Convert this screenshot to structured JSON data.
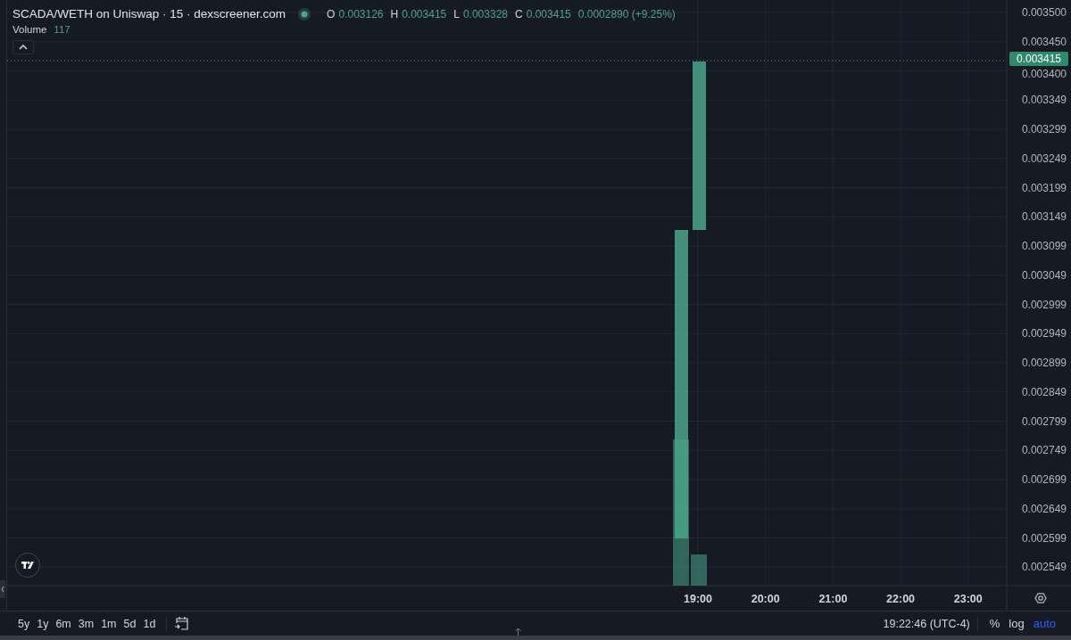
{
  "header": {
    "title": "SCADA/WETH on Uniswap · 15 · dexscreener.com",
    "ohlc": [
      {
        "label": "O",
        "value": "0.003126"
      },
      {
        "label": "H",
        "value": "0.003415"
      },
      {
        "label": "L",
        "value": "0.003328"
      },
      {
        "label": "C",
        "value": "0.003415"
      }
    ],
    "change": "0.0002890 (+9.25%)",
    "volume_label": "Volume",
    "volume_value": "117"
  },
  "price_label": "0.003415",
  "price_axis": [
    "0.003500",
    "0.003450",
    "0.003400",
    "0.003349",
    "0.003299",
    "0.003249",
    "0.003199",
    "0.003149",
    "0.003099",
    "0.003049",
    "0.002999",
    "0.002949",
    "0.002899",
    "0.002849",
    "0.002799",
    "0.002749",
    "0.002699",
    "0.002649",
    "0.002599",
    "0.002549"
  ],
  "time_axis": [
    "19:00",
    "20:00",
    "21:00",
    "22:00",
    "23:00"
  ],
  "ranges": [
    {
      "label": "5y"
    },
    {
      "label": "1y"
    },
    {
      "label": "6m"
    },
    {
      "label": "3m"
    },
    {
      "label": "1m"
    },
    {
      "label": "5d"
    },
    {
      "label": "1d"
    }
  ],
  "time": "19:22:46 (UTC-4)",
  "scale_toggles": [
    {
      "label": "%",
      "selected": false
    },
    {
      "label": "log",
      "selected": false
    },
    {
      "label": "auto",
      "selected": true
    }
  ]
}
